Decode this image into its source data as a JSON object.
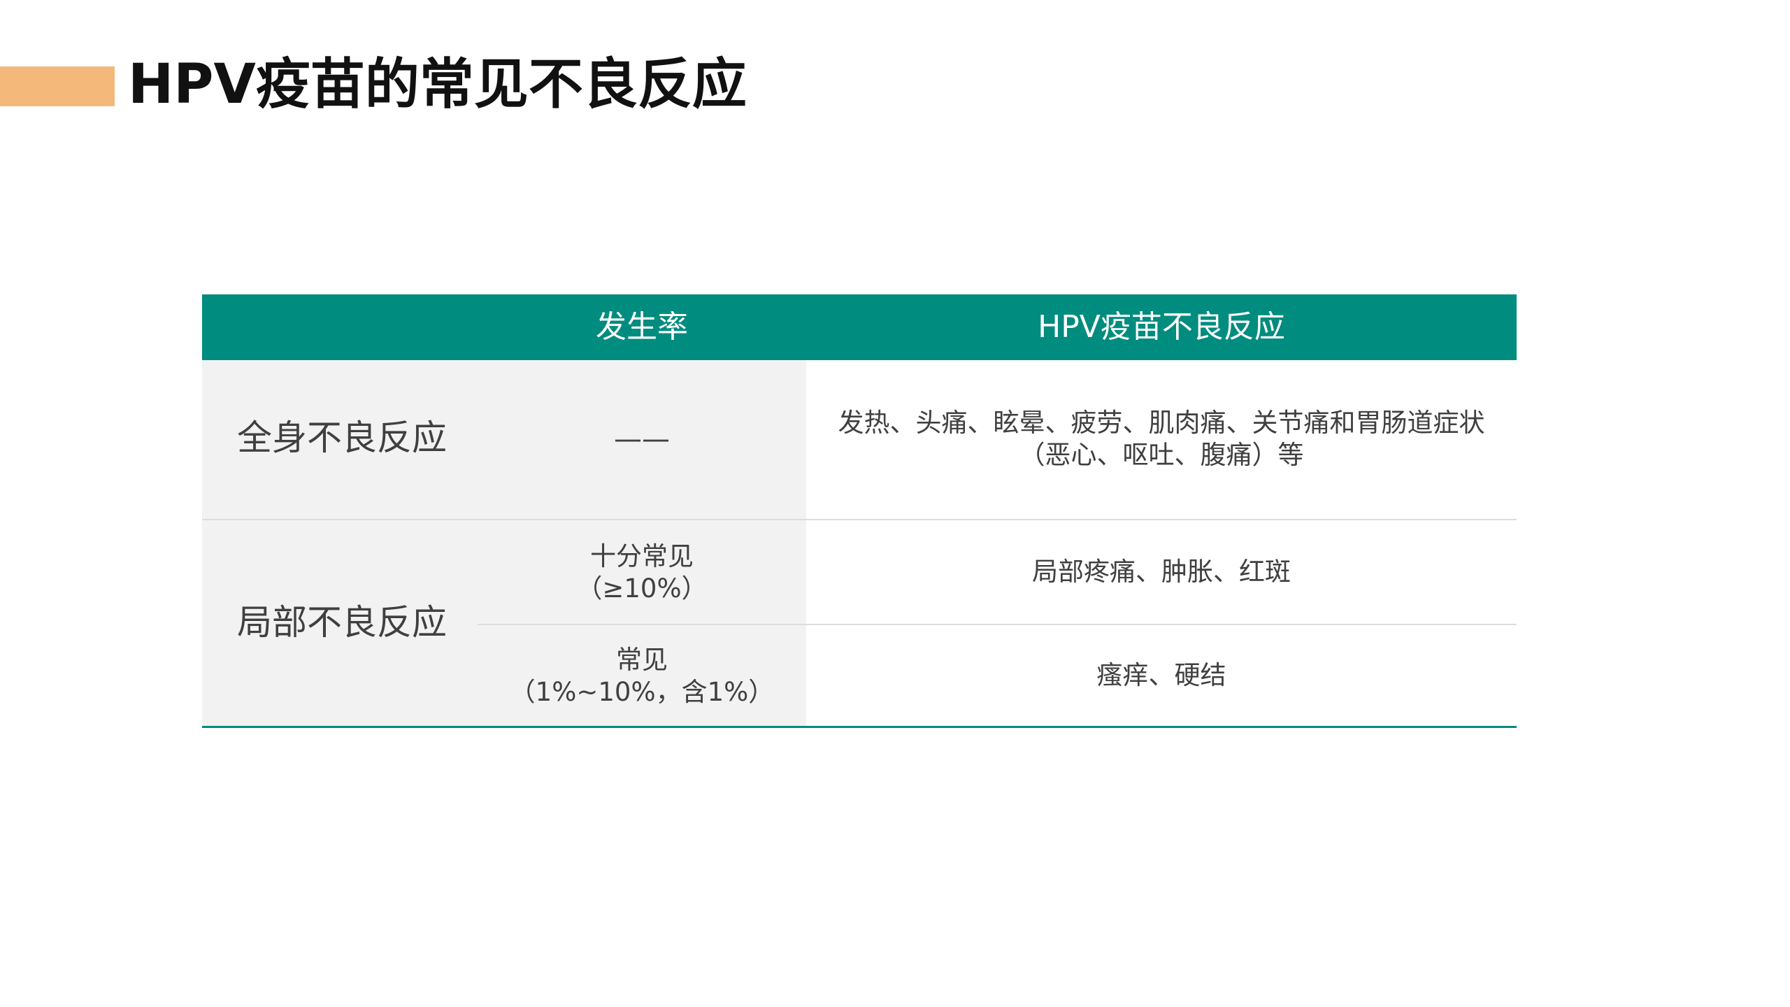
{
  "title": "HPV疫苗的常见不良反应",
  "colors": {
    "accent": "#F4B97A",
    "header": "#008C7E",
    "row_bg": "#F2F2F2"
  },
  "table": {
    "headers": {
      "category": "",
      "rate": "发生率",
      "reaction": "HPV疫苗不良反应"
    },
    "systemic": {
      "category": "全身不良反应",
      "rate": "——",
      "reaction_line1": "发热、头痛、眩晕、疲劳、肌肉痛、关节痛和胃肠道症状",
      "reaction_line2": "（恶心、呕吐、腹痛）等"
    },
    "local": {
      "category": "局部不良反应",
      "very_common": {
        "rate_line1": "十分常见",
        "rate_line2": "（≥10%）",
        "reaction": "局部疼痛、肿胀、红斑"
      },
      "common": {
        "rate_line1": "常见",
        "rate_line2": "（1%~10%，含1%）",
        "reaction": "瘙痒、硬结"
      }
    }
  }
}
